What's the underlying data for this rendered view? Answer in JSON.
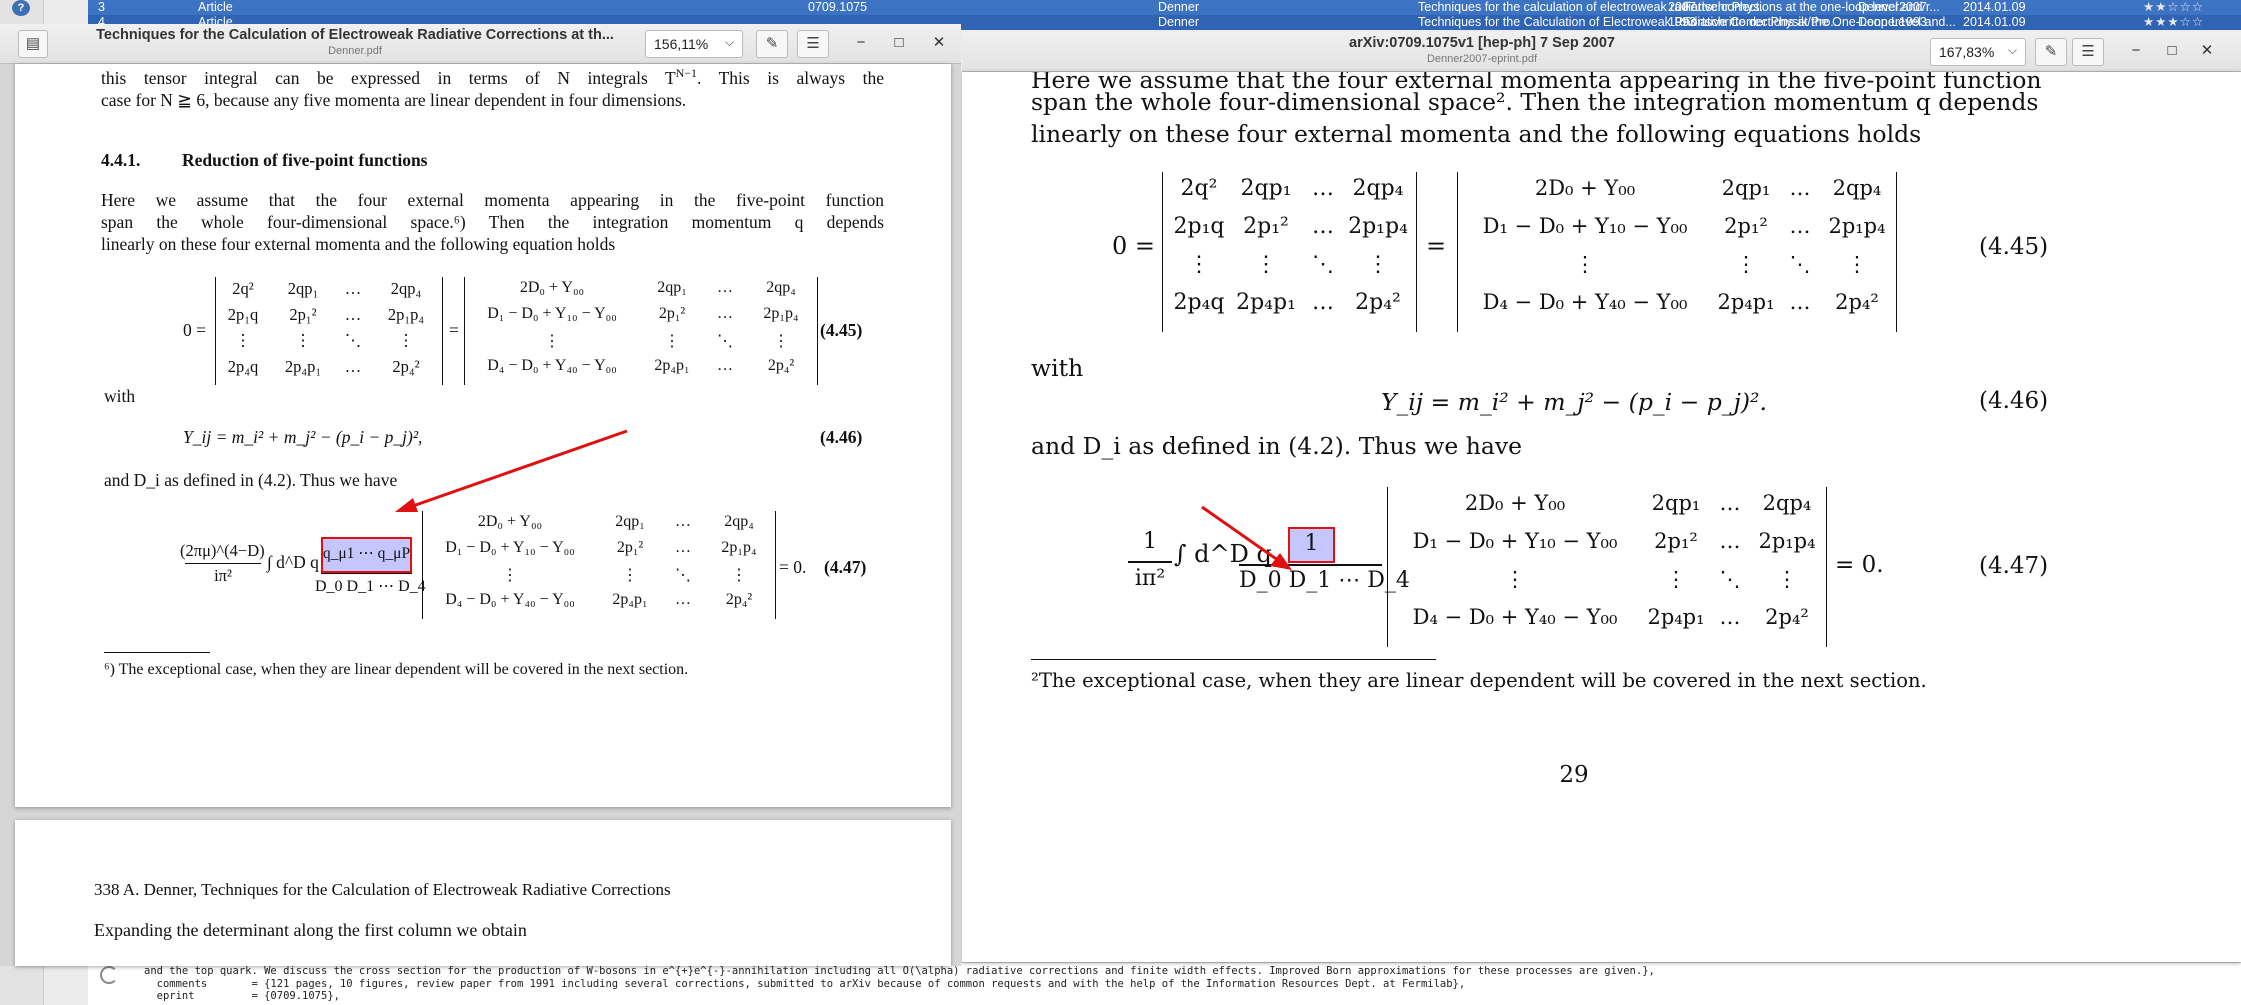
{
  "bg_table": {
    "rows": [
      {
        "num": "3",
        "type": "Article",
        "key": "0709.1075",
        "author": "Denner",
        "title": "Techniques for the calculation of electroweak radiative corrections at the one-loop level and r...",
        "year": "2007",
        "journal": "Fortschr.Phys.",
        "bibkey": "Denner2007",
        "added": "2014.01.09",
        "stars": "★★☆☆☆"
      },
      {
        "num": "4",
        "type": "Article",
        "key": "",
        "author": "Denner",
        "title": "Techniques for the Calculation of Electroweak Radiative Corrections at the One-Loop Level and...",
        "year": "1993",
        "journal": "Fortschritte der Physik/Pro...",
        "bibkey": "Denner1993",
        "added": "2014.01.09",
        "stars": "★★★☆☆"
      }
    ],
    "bibtex_lines": [
      "and the top quark. We discuss the cross section for the production of W-bosons in e^{+}e^{-}-annihilation including all O(\\alpha) radiative corrections and finite width effects. Improved Born approximations for these processes are given.},",
      "  comments       = {121 pages, 10 figures, review paper from 1991 including several corrections, submitted to arXiv because of common requests and with the help of the Information Resources Dept. at Fermilab},",
      "  eprint         = {0709.1075},"
    ]
  },
  "left_window": {
    "title": "Techniques for the Calculation of Electroweak Radiative Corrections at th...",
    "filename": "Denner.pdf",
    "zoom": "156,11%",
    "top_line1": "this tensor integral can be expressed in terms of N integrals T",
    "top_line1_sup": "N−1",
    "top_line1_tail": ". This is always the",
    "top_line2": "case for N ≧ 6, because any five momenta are linear dependent in four dimensions.",
    "section_num": "4.4.1.",
    "section_title": "Reduction of five-point functions",
    "para_line1": "Here we assume that the four external momenta appearing in the five-point function",
    "para_line2": "span the whole four-dimensional space.⁶) Then the integration momentum q depends",
    "para_line3": "linearly on these four external momenta and the following equation holds",
    "eq445_num": "(4.45)",
    "with": "with",
    "eq446": "Y_ij = m_i² + m_j² − (p_i − p_j)²,",
    "eq446_num": "(4.46)",
    "and_line": "and D_i as defined in (4.2). Thus we have",
    "eq447_num": "(4.47)",
    "eq447_prefactor_num": "(2πμ)^(4−D)",
    "eq447_prefactor_den": "iπ²",
    "eq447_integral": "∫ d^D q",
    "eq447_highlight": "q_μ1 ⋯ q_μP",
    "eq447_denominator": "D_0 D_1 ⋯ D_4",
    "eq447_tail": "= 0.",
    "footnote": "⁶) The exceptional case, when they are linear dependent will be covered in the next section.",
    "next_page_header": "338     A. Denner, Techniques for the Calculation of Electroweak Radiative Corrections",
    "next_page_text": "Expanding the determinant along the first column we obtain"
  },
  "right_window": {
    "title": "arXiv:0709.1075v1  [hep-ph]  7 Sep 2007",
    "filename": "Denner2007-eprint.pdf",
    "zoom": "167,83%",
    "top_line0": "Here we assume that the four external momenta appearing in the five-point function",
    "para_line1": "span the whole four-dimensional space². Then the integration momentum q depends",
    "para_line2": "linearly on these four external momenta and the following equations holds",
    "eq445_num": "(4.45)",
    "with": "with",
    "eq446": "Y_ij = m_i² + m_j² − (p_i − p_j)².",
    "eq446_num": "(4.46)",
    "and_line": "and D_i as defined in (4.2). Thus we have",
    "eq447_num": "(4.47)",
    "eq447_prefactor_num": "1",
    "eq447_prefactor_den": "iπ²",
    "eq447_integral": "∫ d^D q",
    "eq447_highlight": "1",
    "eq447_denominator": "D_0 D_1 ⋯ D_4",
    "eq447_tail": "= 0.",
    "footnote": "²The exceptional case, when they are linear dependent will be covered in the next section.",
    "page_number": "29"
  },
  "matrices": {
    "m445_left": [
      [
        "2q²",
        "2qp₁",
        "…",
        "2qp₄"
      ],
      [
        "2p₁q",
        "2p₁²",
        "…",
        "2p₁p₄"
      ],
      [
        "⋮",
        "⋮",
        "⋱",
        "⋮"
      ],
      [
        "2p₄q",
        "2p₄p₁",
        "…",
        "2p₄²"
      ]
    ],
    "m445_right": [
      [
        "2D₀ + Y₀₀",
        "2qp₁",
        "…",
        "2qp₄"
      ],
      [
        "D₁ − D₀ + Y₁₀ − Y₀₀",
        "2p₁²",
        "…",
        "2p₁p₄"
      ],
      [
        "⋮",
        "⋮",
        "⋱",
        "⋮"
      ],
      [
        "D₄ − D₀ + Y₄₀ − Y₀₀",
        "2p₄p₁",
        "…",
        "2p₄²"
      ]
    ],
    "m447": [
      [
        "2D₀ + Y₀₀",
        "2qp₁",
        "…",
        "2qp₄"
      ],
      [
        "D₁ − D₀ + Y₁₀ − Y₀₀",
        "2p₁²",
        "…",
        "2p₁p₄"
      ],
      [
        "⋮",
        "⋮",
        "⋱",
        "⋮"
      ],
      [
        "D₄ − D₀ + Y₄₀ − Y₀₀",
        "2p₄p₁",
        "…",
        "2p₄²"
      ]
    ]
  },
  "colors": {
    "annotation_red": "#e01010",
    "highlight_blue": "#7878ff",
    "selection_blue": "#3c73c2"
  },
  "icons": [
    "help-icon",
    "sidebar-icon",
    "annotate-icon",
    "menu-icon",
    "minimize-icon",
    "maximize-icon",
    "close-icon",
    "chevron-down-icon",
    "refresh-icon",
    "star-icon"
  ]
}
